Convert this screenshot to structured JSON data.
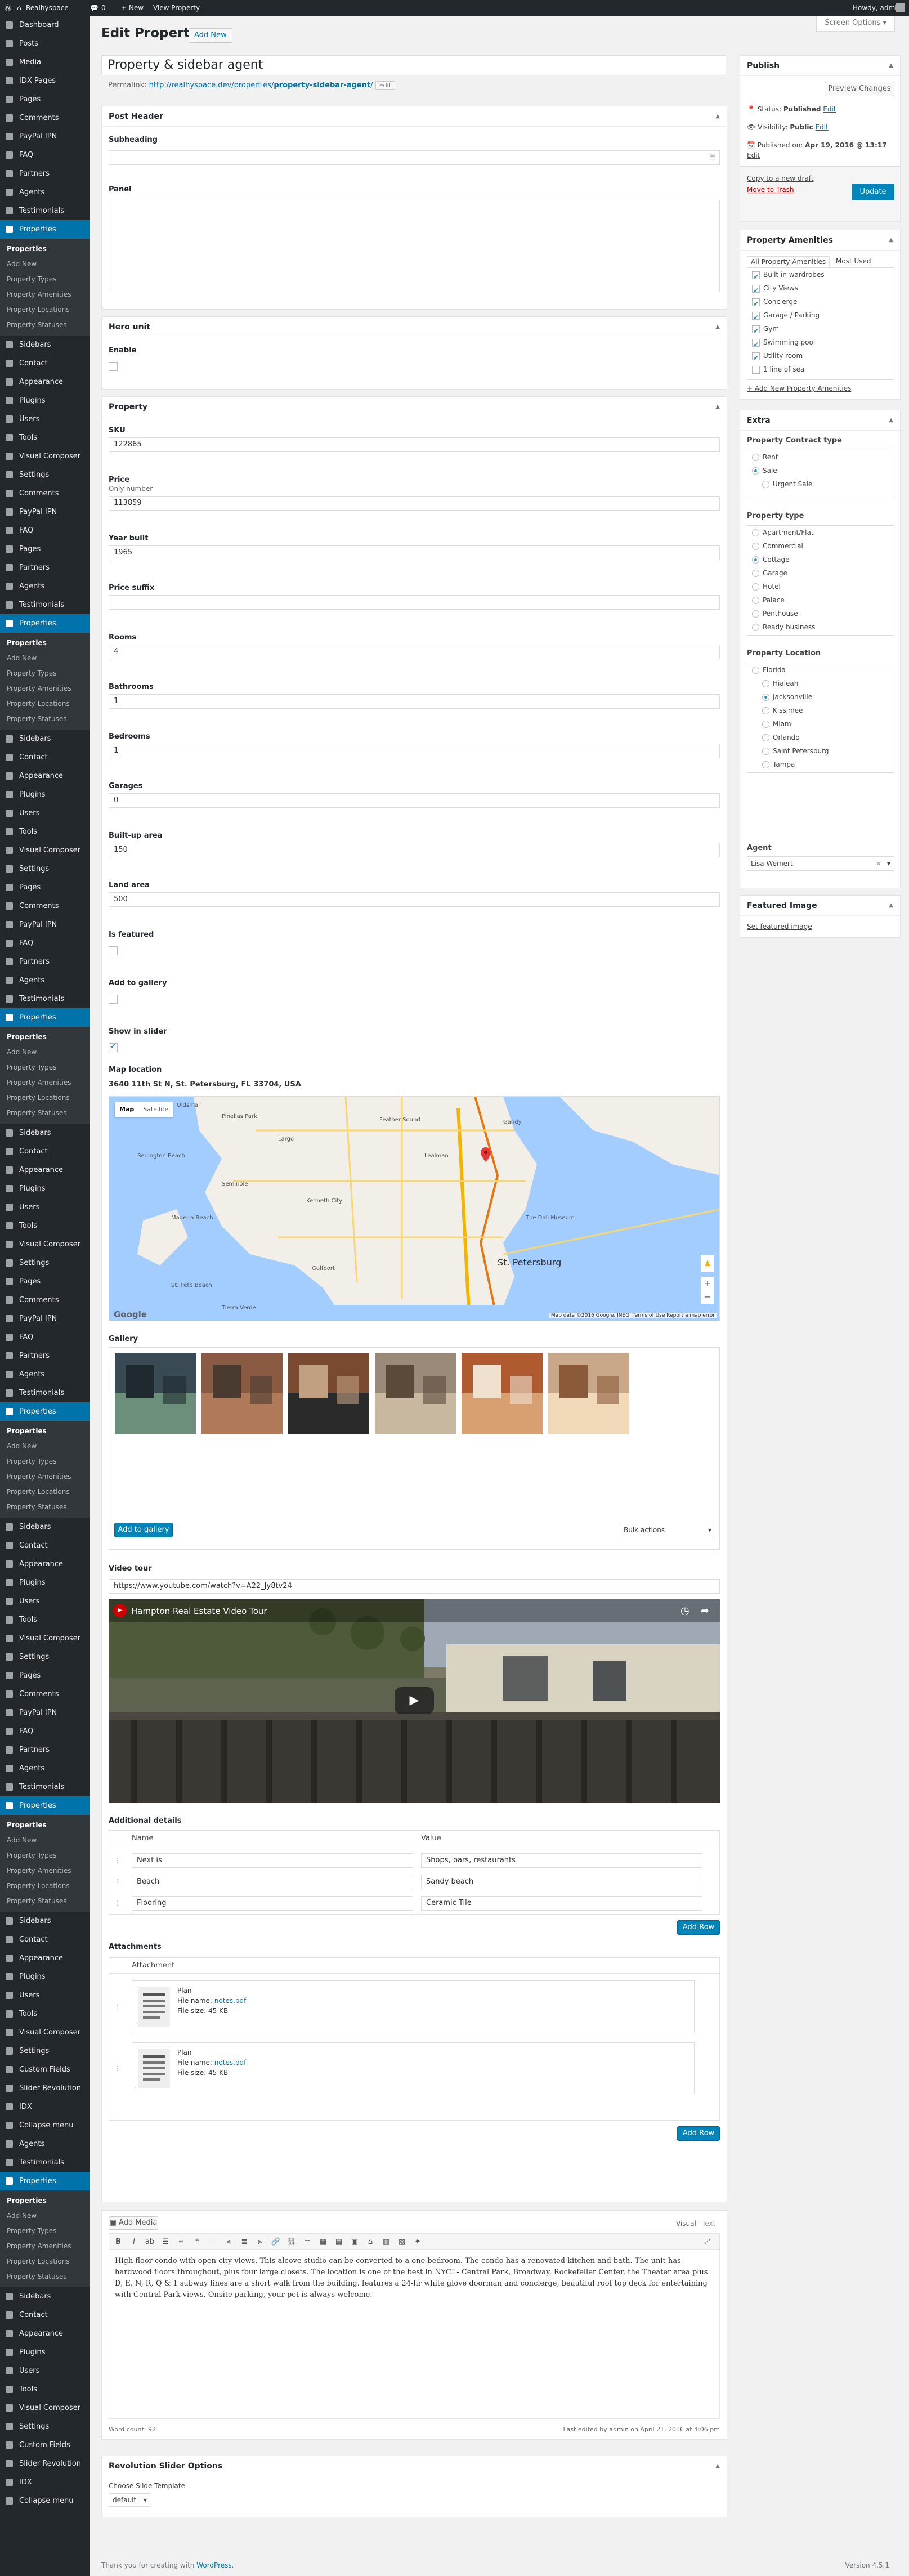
{
  "adminbar": {
    "site_name": "Realhyspace",
    "comments_count": "0",
    "new_label": "+ New",
    "view_property": "View Property",
    "greeting": "Howdy, admin"
  },
  "menu": {
    "groups": [
      {
        "items": [
          "Dashboard",
          "Posts",
          "Media",
          "IDX Pages",
          "Pages",
          "Comments",
          "PayPal IPN",
          "FAQ",
          "Partners",
          "Agents",
          "Testimonials"
        ],
        "active": "Properties",
        "sub": [
          "Properties",
          "Add New",
          "Property Types",
          "Property Amenities",
          "Property Locations",
          "Property Statuses"
        ],
        "after": [
          "Sidebars",
          "Contact",
          "Appearance",
          "Plugins",
          "Users",
          "Tools",
          "Visual Composer",
          "Settings",
          "Comments",
          "PayPal IPN",
          "FAQ",
          "Pages",
          "Partners",
          "Agents",
          "Testimonials"
        ]
      },
      {
        "active": "Properties",
        "sub": [
          "Properties",
          "Add New",
          "Property Types",
          "Property Amenities",
          "Property Locations",
          "Property Statuses"
        ],
        "after": [
          "Sidebars",
          "Contact",
          "Appearance",
          "Plugins",
          "Users",
          "Tools",
          "Visual Composer",
          "Settings",
          "Pages",
          "Comments",
          "PayPal IPN",
          "FAQ",
          "Partners",
          "Agents",
          "Testimonials"
        ]
      },
      {
        "active": "Properties",
        "sub": [
          "Properties",
          "Add New",
          "Property Types",
          "Property Amenities",
          "Property Locations",
          "Property Statuses"
        ],
        "after": [
          "Sidebars",
          "Contact",
          "Appearance",
          "Plugins",
          "Users",
          "Tools",
          "Visual Composer",
          "Settings",
          "Pages",
          "Comments",
          "PayPal IPN",
          "FAQ",
          "Partners",
          "Agents",
          "Testimonials"
        ]
      },
      {
        "active": "Properties",
        "sub": [
          "Properties",
          "Add New",
          "Property Types",
          "Property Amenities",
          "Property Locations",
          "Property Statuses"
        ],
        "after": [
          "Sidebars",
          "Contact",
          "Appearance",
          "Plugins",
          "Users",
          "Tools",
          "Visual Composer",
          "Settings",
          "Pages",
          "Comments",
          "PayPal IPN",
          "FAQ",
          "Partners",
          "Agents",
          "Testimonials"
        ]
      },
      {
        "active": "Properties",
        "sub": [
          "Properties",
          "Add New",
          "Property Types",
          "Property Amenities",
          "Property Locations",
          "Property Statuses"
        ],
        "after": [
          "Sidebars",
          "Contact",
          "Appearance",
          "Plugins",
          "Users",
          "Tools",
          "Visual Composer",
          "Settings",
          "Custom Fields",
          "Slider Revolution",
          "IDX",
          "Collapse menu",
          "Agents",
          "Testimonials"
        ]
      },
      {
        "active": "Properties",
        "sub": [
          "Properties",
          "Add New",
          "Property Types",
          "Property Amenities",
          "Property Locations",
          "Property Statuses"
        ],
        "after": [
          "Sidebars",
          "Contact",
          "Appearance",
          "Plugins",
          "Users",
          "Tools",
          "Visual Composer",
          "Settings",
          "Custom Fields",
          "Slider Revolution",
          "IDX",
          "Collapse menu"
        ]
      }
    ]
  },
  "page": {
    "title": "Edit Property",
    "add_new": "Add New",
    "screen_options": "Screen Options ▾",
    "post_title": "Property & sidebar agent",
    "permalink_label": "Permalink:",
    "permalink_base": "http://realhyspace.dev/properties/",
    "permalink_slug": "property-sidebar-agent",
    "permalink_tail": "/",
    "edit_btn": "Edit"
  },
  "post_header": {
    "title": "Post Header",
    "subheading_label": "Subheading",
    "panel_label": "Panel"
  },
  "hero": {
    "title": "Hero unit",
    "enable_label": "Enable"
  },
  "property": {
    "title": "Property",
    "fields": [
      {
        "label": "SKU",
        "value": "122865"
      },
      {
        "label": "Price",
        "sub": "Only number",
        "value": "113859"
      },
      {
        "label": "Year built",
        "value": "1965"
      },
      {
        "label": "Price suffix",
        "value": ""
      },
      {
        "label": "Rooms",
        "value": "4"
      },
      {
        "label": "Bathrooms",
        "value": "1"
      },
      {
        "label": "Bedrooms",
        "value": "1"
      },
      {
        "label": "Garages",
        "value": "0"
      },
      {
        "label": "Built-up area",
        "value": "150"
      },
      {
        "label": "Land area",
        "value": "500"
      }
    ],
    "checks": [
      {
        "label": "Is featured",
        "checked": false
      },
      {
        "label": "Add to gallery",
        "checked": false
      },
      {
        "label": "Show in slider",
        "checked": true
      }
    ],
    "map_label": "Map location",
    "map_address": "3640 11th St N, St. Petersburg, FL 33704, USA",
    "map_tab_map": "Map",
    "map_tab_satellite": "Satellite",
    "map_city": "St. Petersburg",
    "map_labels": [
      "Pinellas Park",
      "Feather Sound",
      "Oldsmar",
      "Largo",
      "Seminole",
      "Kenneth City",
      "Madeira Beach",
      "St. Pete Beach",
      "Gulfport",
      "Redington Beach",
      "The Dali Museum",
      "Lealman",
      "Gandy",
      "Tierra Verde"
    ],
    "map_footer": "Map data ©2016 Google, INEGI    Terms of Use    Report a map error",
    "map_google": "Google",
    "gallery_label": "Gallery",
    "add_gallery": "Add to gallery",
    "bulk_actions": "Bulk actions",
    "video_label": "Video tour",
    "video_url": "https://www.youtube.com/watch?v=A22_Jy8tv24",
    "video_title": "Hampton Real Estate Video Tour",
    "additional_label": "Additional details",
    "col_name": "Name",
    "col_value": "Value",
    "details": [
      {
        "name": "Next is",
        "value": "Shops, bars, restaurants"
      },
      {
        "name": "Beach",
        "value": "Sandy beach"
      },
      {
        "name": "Flooring",
        "value": "Ceramic Tile"
      }
    ],
    "add_row": "Add Row",
    "attachments_label": "Attachments",
    "attachment_col": "Attachment",
    "attachments": [
      {
        "title": "Plan",
        "file_label": "File name:",
        "file_name": "notes.pdf",
        "size": "File size: 45 KB"
      },
      {
        "title": "Plan",
        "file_label": "File name:",
        "file_name": "notes.pdf",
        "size": "File size: 45 KB"
      }
    ]
  },
  "editor": {
    "add_media": "Add Media",
    "tab_visual": "Visual",
    "tab_text": "Text",
    "content": "High floor condo with open city views. This alcove studio can be converted to a one bedroom. The condo has a renovated kitchen and bath. The unit has hardwood floors throughout, plus four large closets. The location is one of the best in NYC! - Central Park, Broadway, Rockefeller Center, the Theater area plus D, E, N, R, Q & 1 subway lines are a short walk from the building. features a 24-hr white glove doorman and concierge, beautiful roof top deck for entertaining with Central Park views. Onsite parking, your pet is always welcome.",
    "word_count": "Word count: 92",
    "last_edited": "Last edited by admin on April 21, 2016 at 4:06 pm"
  },
  "revslider": {
    "title": "Revolution Slider Options",
    "choose_label": "Choose Slide Template",
    "value": "default"
  },
  "publish": {
    "title": "Publish",
    "preview": "Preview Changes",
    "status_label": "Status:",
    "status": "Published",
    "visibility_label": "Visibility:",
    "visibility": "Public",
    "published_label": "Published on:",
    "published": "Apr 19, 2016 @ 13:17",
    "edit": "Edit",
    "copy_draft": "Copy to a new draft",
    "trash": "Move to Trash",
    "update": "Update"
  },
  "amenities": {
    "title": "Property Amenities",
    "tab_all": "All Property Amenities",
    "tab_used": "Most Used",
    "items": [
      {
        "label": "Built in wardrobes",
        "checked": true
      },
      {
        "label": "City Views",
        "checked": true
      },
      {
        "label": "Concierge",
        "checked": true
      },
      {
        "label": "Garage / Parking",
        "checked": true
      },
      {
        "label": "Gym",
        "checked": true
      },
      {
        "label": "Swimming pool",
        "checked": true
      },
      {
        "label": "Utility room",
        "checked": true
      },
      {
        "label": "1 line of sea",
        "checked": false
      }
    ],
    "add_new": "+ Add New Property Amenities"
  },
  "extra": {
    "title": "Extra",
    "contract_label": "Property Contract type",
    "contract": [
      {
        "label": "Rent",
        "on": false,
        "indent": false
      },
      {
        "label": "Sale",
        "on": true,
        "indent": false
      },
      {
        "label": "Urgent Sale",
        "on": false,
        "indent": true
      }
    ],
    "type_label": "Property type",
    "types": [
      {
        "label": "Apartment/Flat",
        "on": false
      },
      {
        "label": "Commercial",
        "on": false
      },
      {
        "label": "Cottage",
        "on": true
      },
      {
        "label": "Garage",
        "on": false
      },
      {
        "label": "Hotel",
        "on": false
      },
      {
        "label": "Palace",
        "on": false
      },
      {
        "label": "Penthouse",
        "on": false
      },
      {
        "label": "Ready business",
        "on": false
      }
    ],
    "location_label": "Property Location",
    "locations": [
      {
        "label": "Florida",
        "on": false,
        "indent": false
      },
      {
        "label": "Hialeah",
        "on": false,
        "indent": true
      },
      {
        "label": "Jacksonville",
        "on": true,
        "indent": true
      },
      {
        "label": "Kissimee",
        "on": false,
        "indent": true
      },
      {
        "label": "Miami",
        "on": false,
        "indent": true
      },
      {
        "label": "Orlando",
        "on": false,
        "indent": true
      },
      {
        "label": "Saint Petersburg",
        "on": false,
        "indent": true
      },
      {
        "label": "Tampa",
        "on": false,
        "indent": true
      }
    ],
    "agent_label": "Agent",
    "agent_value": "Lisa Wemert"
  },
  "featured": {
    "title": "Featured Image",
    "link": "Set featured image"
  },
  "footer": {
    "thanks": "Thank you for creating with",
    "wp": "WordPress",
    "dot": ".",
    "version": "Version 4.5.1"
  },
  "colors": {
    "accent": "#0073aa",
    "menu_bg": "#23282d",
    "button": "#0085ba",
    "trash": "#a00"
  }
}
